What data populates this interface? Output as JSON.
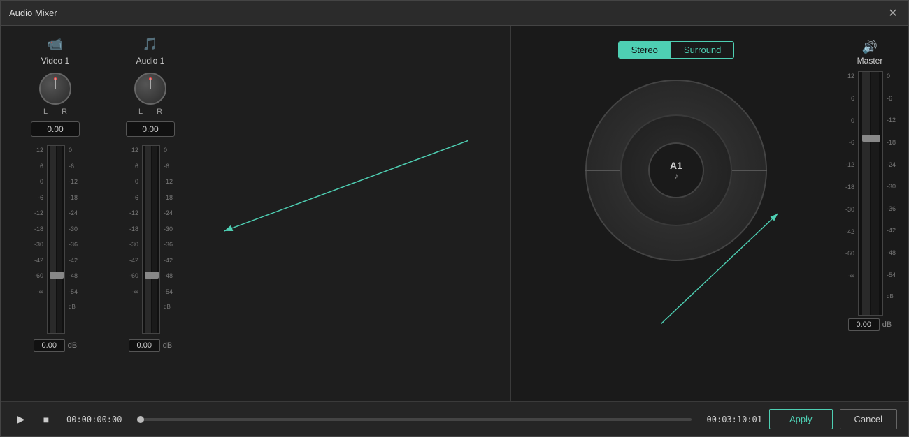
{
  "window": {
    "title": "Audio Mixer"
  },
  "left_panel": {
    "channels": [
      {
        "id": "video1",
        "icon": "🎥",
        "label": "Video  1",
        "knob_value": "0.00",
        "l_label": "L",
        "r_label": "R",
        "fader_value": "0.00",
        "db_unit": "dB",
        "scale_left": [
          "12",
          "6",
          "0",
          "-6",
          "-12",
          "-18",
          "-30",
          "-42",
          "-60",
          "-∞"
        ],
        "scale_right": [
          "0",
          "-6",
          "-12",
          "-18",
          "-24",
          "-30",
          "-36",
          "-42",
          "-48",
          "-54",
          "dB"
        ]
      },
      {
        "id": "audio1",
        "icon": "🎵",
        "label": "Audio  1",
        "knob_value": "0.00",
        "l_label": "L",
        "r_label": "R",
        "fader_value": "0.00",
        "db_unit": "dB",
        "scale_left": [
          "12",
          "6",
          "0",
          "-6",
          "-12",
          "-18",
          "-30",
          "-42",
          "-60",
          "-∞"
        ],
        "scale_right": [
          "0",
          "-6",
          "-12",
          "-18",
          "-24",
          "-30",
          "-36",
          "-42",
          "-48",
          "-54",
          "dB"
        ]
      }
    ]
  },
  "right_panel": {
    "toggle": {
      "stereo_label": "Stereo",
      "surround_label": "Surround",
      "active": "stereo"
    },
    "audio_node": {
      "label": "A1",
      "icon": "♪"
    },
    "master": {
      "icon": "🔊",
      "label": "Master",
      "scale": [
        "0",
        "-6",
        "-12",
        "-18",
        "-24",
        "-30",
        "-36",
        "-42",
        "-48",
        "-54",
        "dB"
      ],
      "left_scale": [
        "12",
        "6",
        "0",
        "-6",
        "-12",
        "-18",
        "-30",
        "-42",
        "-60",
        "-∞"
      ],
      "fader_value": "0.00",
      "db_unit": "dB"
    }
  },
  "bottom_bar": {
    "play_label": "▶",
    "stop_label": "■",
    "time_start": "00:00:00:00",
    "time_end": "00:03:10:01",
    "apply_label": "Apply",
    "cancel_label": "Cancel"
  }
}
